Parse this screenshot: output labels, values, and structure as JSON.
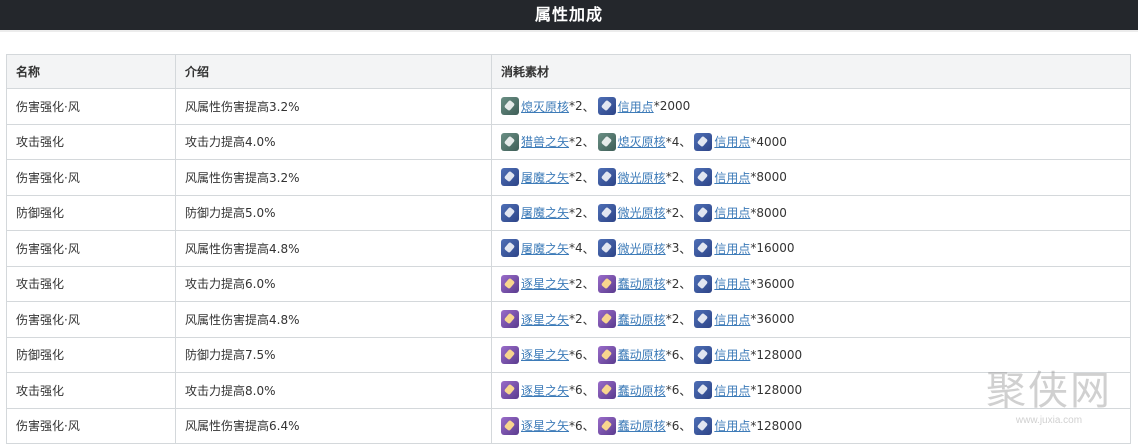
{
  "header": {
    "title": "属性加成"
  },
  "table": {
    "columns": [
      "名称",
      "介绍",
      "消耗素材"
    ],
    "rows": [
      {
        "name": "伤害强化·风",
        "desc": "风属性伤害提高3.2%",
        "materials": [
          {
            "icon": "green",
            "label": "熄灭原核",
            "count": "*2"
          },
          {
            "icon": "blue",
            "label": "信用点",
            "count": "*2000"
          }
        ]
      },
      {
        "name": "攻击强化",
        "desc": "攻击力提高4.0%",
        "materials": [
          {
            "icon": "green",
            "label": "猎兽之矢",
            "count": "*2"
          },
          {
            "icon": "green",
            "label": "熄灭原核",
            "count": "*4"
          },
          {
            "icon": "blue",
            "label": "信用点",
            "count": "*4000"
          }
        ]
      },
      {
        "name": "伤害强化·风",
        "desc": "风属性伤害提高3.2%",
        "materials": [
          {
            "icon": "blue",
            "label": "屠魔之矢",
            "count": "*2"
          },
          {
            "icon": "blue",
            "label": "微光原核",
            "count": "*2"
          },
          {
            "icon": "blue",
            "label": "信用点",
            "count": "*8000"
          }
        ]
      },
      {
        "name": "防御强化",
        "desc": "防御力提高5.0%",
        "materials": [
          {
            "icon": "blue",
            "label": "屠魔之矢",
            "count": "*2"
          },
          {
            "icon": "blue",
            "label": "微光原核",
            "count": "*2"
          },
          {
            "icon": "blue",
            "label": "信用点",
            "count": "*8000"
          }
        ]
      },
      {
        "name": "伤害强化·风",
        "desc": "风属性伤害提高4.8%",
        "materials": [
          {
            "icon": "blue",
            "label": "屠魔之矢",
            "count": "*4"
          },
          {
            "icon": "blue",
            "label": "微光原核",
            "count": "*3"
          },
          {
            "icon": "blue",
            "label": "信用点",
            "count": "*16000"
          }
        ]
      },
      {
        "name": "攻击强化",
        "desc": "攻击力提高6.0%",
        "materials": [
          {
            "icon": "purple",
            "label": "逐星之矢",
            "count": "*2"
          },
          {
            "icon": "purple",
            "label": "蠢动原核",
            "count": "*2"
          },
          {
            "icon": "blue",
            "label": "信用点",
            "count": "*36000"
          }
        ]
      },
      {
        "name": "伤害强化·风",
        "desc": "风属性伤害提高4.8%",
        "materials": [
          {
            "icon": "purple",
            "label": "逐星之矢",
            "count": "*2"
          },
          {
            "icon": "purple",
            "label": "蠢动原核",
            "count": "*2"
          },
          {
            "icon": "blue",
            "label": "信用点",
            "count": "*36000"
          }
        ]
      },
      {
        "name": "防御强化",
        "desc": "防御力提高7.5%",
        "materials": [
          {
            "icon": "purple",
            "label": "逐星之矢",
            "count": "*6"
          },
          {
            "icon": "purple",
            "label": "蠢动原核",
            "count": "*6"
          },
          {
            "icon": "blue",
            "label": "信用点",
            "count": "*128000"
          }
        ]
      },
      {
        "name": "攻击强化",
        "desc": "攻击力提高8.0%",
        "materials": [
          {
            "icon": "purple",
            "label": "逐星之矢",
            "count": "*6"
          },
          {
            "icon": "purple",
            "label": "蠢动原核",
            "count": "*6"
          },
          {
            "icon": "blue",
            "label": "信用点",
            "count": "*128000"
          }
        ]
      },
      {
        "name": "伤害强化·风",
        "desc": "风属性伤害提高6.4%",
        "materials": [
          {
            "icon": "purple",
            "label": "逐星之矢",
            "count": "*6"
          },
          {
            "icon": "purple",
            "label": "蠢动原核",
            "count": "*6"
          },
          {
            "icon": "blue",
            "label": "信用点",
            "count": "*128000"
          }
        ]
      }
    ]
  },
  "watermark": {
    "text": "聚侠网",
    "url": "www.juxia.com"
  },
  "colors": {
    "title_bg": "#24272c",
    "link": "#3d7bb8",
    "header_bg": "#f3f4f5",
    "border": "#d4d8db"
  }
}
